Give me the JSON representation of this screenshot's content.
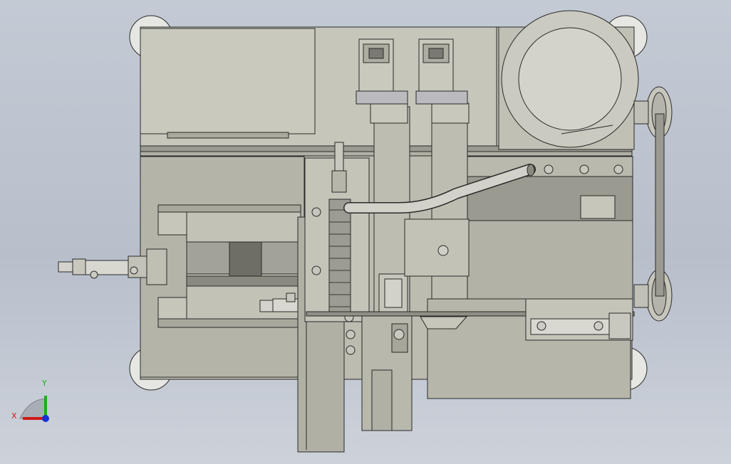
{
  "viewport": {
    "background_top": "#c4cad4",
    "background_bottom": "#cdd2da"
  },
  "palette": {
    "body": "#bcbcb0",
    "body_light": "#c9c9be",
    "body_dark": "#8e8e84",
    "line": "#2a2a2a",
    "metal": "#a8aaa2"
  },
  "triad": {
    "x_label": "X",
    "y_label": "Y",
    "x_color": "#d01818",
    "y_color": "#18b018",
    "z_color": "#1830d0"
  },
  "components": [
    "machine-base-plate",
    "left-upper-cover-panel",
    "servo-motor-left",
    "servo-motor-right",
    "main-drive-motor",
    "belt-pulley-upper",
    "belt-pulley-lower",
    "drive-belt",
    "bent-tube",
    "left-pneumatic-cylinder",
    "right-pneumatic-cylinder",
    "small-left-cylinder",
    "vertical-feed-rail",
    "gear-rack-assembly",
    "leveling-foot-top-left",
    "leveling-foot-top-right",
    "leveling-foot-bottom-left",
    "leveling-foot-bottom-right"
  ]
}
